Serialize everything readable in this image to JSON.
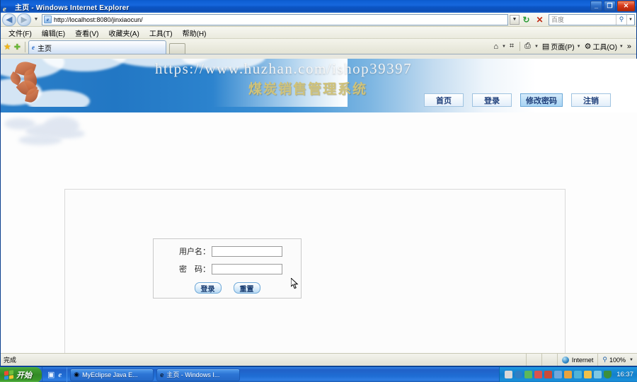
{
  "window": {
    "title": "主页 - Windows Internet Explorer",
    "minimize_label": "_",
    "restore_label": "❐",
    "close_label": "✕"
  },
  "address_bar": {
    "back_label": "◀",
    "forward_label": "▶",
    "history_caret": "▼",
    "url": "http://localhost:8080/jinxiaocun/",
    "url_caret": "▼",
    "refresh_icon": "↻",
    "stop_icon": "✕",
    "search_placeholder": "百度",
    "search_go_icon": "search-icon",
    "search_caret": "▼"
  },
  "menu": {
    "items": [
      {
        "label": "文件(F)"
      },
      {
        "label": "编辑(E)"
      },
      {
        "label": "查看(V)"
      },
      {
        "label": "收藏夹(A)"
      },
      {
        "label": "工具(T)"
      },
      {
        "label": "帮助(H)"
      }
    ]
  },
  "tabs": {
    "favorites_star": "★",
    "add_favorite": "✚",
    "active_tab_label": "主页",
    "new_tab_label": ""
  },
  "command_bar": {
    "items": [
      {
        "name": "home",
        "glyph": "⌂",
        "label": "",
        "caret": "▼"
      },
      {
        "name": "feeds",
        "glyph": "⌗",
        "label": "",
        "caret": ""
      },
      {
        "name": "print",
        "glyph": "⎙",
        "label": "",
        "caret": "▼"
      },
      {
        "name": "page",
        "glyph": "▤",
        "label": "页面(P)",
        "caret": "▼"
      },
      {
        "name": "tools",
        "glyph": "⚙",
        "label": "工具(O)",
        "caret": "▼"
      }
    ],
    "overflow": "»"
  },
  "page": {
    "banner": {
      "watermark": "https://www.huzhan.com/ishop39397",
      "system_title": "煤炭销售管理系统"
    },
    "nav": [
      {
        "label": "首页",
        "active": false
      },
      {
        "label": "登录",
        "active": false
      },
      {
        "label": "修改密码",
        "active": true
      },
      {
        "label": "注销",
        "active": false
      }
    ],
    "login": {
      "username_label": "用户名：",
      "username_value": "",
      "password_label": "密　码：",
      "password_value": "",
      "submit_label": "登录",
      "reset_label": "重置"
    }
  },
  "status_bar": {
    "message": "完成",
    "zone": "Internet",
    "zoom": "100%",
    "zoom_caret": "▼"
  },
  "taskbar": {
    "start_label": "开始",
    "quick_launch": [
      {
        "name": "show-desktop-icon",
        "glyph": "▣"
      },
      {
        "name": "internet-explorer-icon",
        "glyph": "e"
      }
    ],
    "items": [
      {
        "icon": "myeclipse-icon",
        "label": "MyEclipse Java E..."
      },
      {
        "icon": "internet-explorer-icon",
        "label": "主页 - Windows I..."
      }
    ],
    "clock": "16:37"
  },
  "colors": {
    "titlebar_blue": "#1667dd",
    "banner_blue": "#2a7fc9",
    "nav_text": "#1f3f7a",
    "title_gold": "#cfc27a",
    "taskbar_blue": "#2061c8",
    "start_green": "#338a26"
  }
}
